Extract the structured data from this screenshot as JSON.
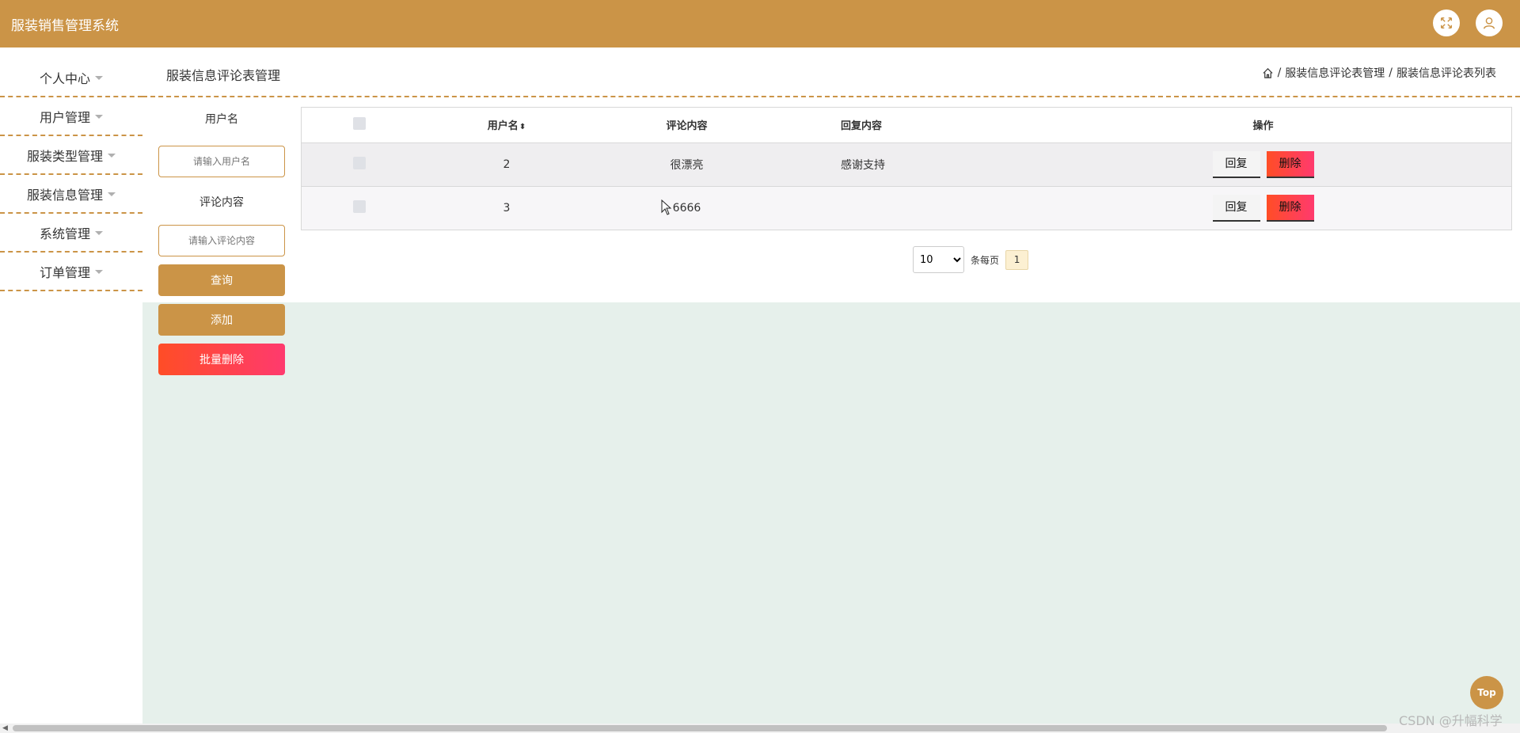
{
  "app": {
    "title": "服装销售管理系统"
  },
  "topbar": {
    "icons": [
      "fullscreen-icon",
      "user-icon"
    ]
  },
  "sidebar": {
    "items": [
      {
        "label": "个人中心"
      },
      {
        "label": "用户管理"
      },
      {
        "label": "服装类型管理"
      },
      {
        "label": "服装信息管理"
      },
      {
        "label": "系统管理"
      },
      {
        "label": "订单管理"
      }
    ]
  },
  "header": {
    "title": "服装信息评论表管理",
    "breadcrumb": [
      "服装信息评论表管理",
      "服装信息评论表列表"
    ]
  },
  "search": {
    "username_label": "用户名",
    "username_placeholder": "请输入用户名",
    "comment_label": "评论内容",
    "comment_placeholder": "请输入评论内容",
    "query_button": "查询",
    "add_button": "添加",
    "batch_delete_button": "批量删除"
  },
  "table": {
    "columns": [
      "用户名",
      "评论内容",
      "回复内容",
      "操作"
    ],
    "rows": [
      {
        "username": "2",
        "comment": "很漂亮",
        "reply": "感谢支持"
      },
      {
        "username": "3",
        "comment": "6666",
        "reply": ""
      }
    ],
    "reply_label": "回复",
    "delete_label": "删除"
  },
  "pagination": {
    "page_size": "10",
    "page_size_options": [
      "10"
    ],
    "per_page_label": "条每页",
    "current_page": "1"
  },
  "top_button": "Top",
  "watermark": "CSDN @升幅科学",
  "colors": {
    "accent": "#cb9447",
    "danger": "#ff4d26",
    "content_bg": "#e6f0eb"
  }
}
